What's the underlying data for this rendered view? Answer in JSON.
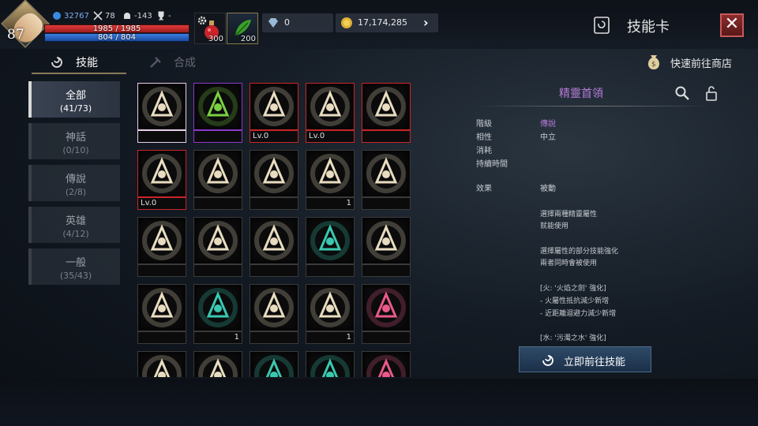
{
  "player": {
    "level": "87",
    "power": "32767",
    "stat_a": "78",
    "stat_b": "-143",
    "stat_c": "-",
    "hp": "1985 / 1985",
    "mp": "804 / 804"
  },
  "consumables": [
    {
      "name": "potion-icon",
      "qty": "300"
    },
    {
      "name": "herb-icon",
      "qty": "200"
    }
  ],
  "currencies": [
    {
      "icon": "diamond-icon",
      "value": "0"
    },
    {
      "icon": "gold-coin-icon",
      "value": "17,174,285"
    }
  ],
  "window": {
    "title": "技能卡",
    "close": "✕"
  },
  "tabs": [
    {
      "label": "技能",
      "active": true
    },
    {
      "label": "合成",
      "active": false
    }
  ],
  "shop_link": "快速前往商店",
  "categories": [
    {
      "name": "全部",
      "count": "(41/73)",
      "active": true
    },
    {
      "name": "神話",
      "count": "(0/10)"
    },
    {
      "name": "傳說",
      "count": "(2/8)"
    },
    {
      "name": "英雄",
      "count": "(4/12)"
    },
    {
      "name": "一般",
      "count": "(35/43)"
    }
  ],
  "cards": [
    {
      "icon": "elemental-shield-icon",
      "rarity": "god",
      "left": "",
      "right": ""
    },
    {
      "icon": "thorn-beast-icon",
      "rarity": "myth",
      "left": "",
      "right": ""
    },
    {
      "icon": "bow-shield-icon",
      "rarity": "leg",
      "left": "Lv.0",
      "right": ""
    },
    {
      "icon": "crossed-blades-icon",
      "rarity": "leg",
      "left": "Lv.0",
      "right": ""
    },
    {
      "icon": "skull-target-icon",
      "rarity": "leg",
      "left": "",
      "right": ""
    },
    {
      "icon": "dragon-wing-icon",
      "rarity": "leg",
      "left": "Lv.0",
      "right": ""
    },
    {
      "icon": "shield-sword-icon",
      "rarity": "none",
      "left": "",
      "right": ""
    },
    {
      "icon": "lightning-sword-icon",
      "rarity": "none",
      "left": "",
      "right": ""
    },
    {
      "icon": "curved-arrow-icon",
      "rarity": "none",
      "left": "",
      "right": "1"
    },
    {
      "icon": "starburst-icon",
      "rarity": "none",
      "left": "",
      "right": ""
    },
    {
      "icon": "anvil-hand-icon",
      "rarity": "none",
      "left": "",
      "right": ""
    },
    {
      "icon": "slash-eye-icon",
      "rarity": "none",
      "left": "",
      "right": ""
    },
    {
      "icon": "spiked-circle-icon",
      "rarity": "none",
      "left": "",
      "right": ""
    },
    {
      "icon": "teal-sword-burst-icon",
      "rarity": "none",
      "left": "",
      "right": ""
    },
    {
      "icon": "orb-spring-icon",
      "rarity": "none",
      "left": "",
      "right": ""
    },
    {
      "icon": "crosshair-person-icon",
      "rarity": "none",
      "left": "",
      "right": ""
    },
    {
      "icon": "cycle-arrows-icon",
      "rarity": "none",
      "left": "",
      "right": "1"
    },
    {
      "icon": "sparkle-burst-icon",
      "rarity": "none",
      "left": "",
      "right": ""
    },
    {
      "icon": "shatter-icon",
      "rarity": "none",
      "left": "",
      "right": "1"
    },
    {
      "icon": "pink-wing-icon",
      "rarity": "none",
      "left": "",
      "right": ""
    },
    {
      "icon": "moon-orb-icon",
      "rarity": "none",
      "left": "",
      "right": ""
    },
    {
      "icon": "flame-claw-icon",
      "rarity": "none",
      "left": "",
      "right": ""
    },
    {
      "icon": "teal-spike-icon",
      "rarity": "none",
      "left": "",
      "right": ""
    },
    {
      "icon": "teal-sparkle-icon",
      "rarity": "none",
      "left": "",
      "right": ""
    },
    {
      "icon": "pink-paws-icon",
      "rarity": "none",
      "left": "",
      "right": ""
    }
  ],
  "detail": {
    "name": "精靈首領",
    "props": [
      {
        "label": "階級",
        "value": "傳說",
        "color": "#b57bd8"
      },
      {
        "label": "相性",
        "value": "中立"
      },
      {
        "label": "消耗",
        "value": ""
      },
      {
        "label": "持續時間",
        "value": ""
      },
      {
        "label": "效果",
        "value": "被動"
      }
    ],
    "desc": [
      "選擇兩種精靈屬性",
      "就能使用",
      "選擇屬性的部分技能強化",
      "兩者同時會被使用",
      "[火: '火焰之劍' 強化]",
      "- 火屬性抵抗減少新增",
      "- 近距離迴避力減少新增",
      "[水: '污濁之水' 強化]"
    ],
    "goto_label": "立即前往技能"
  }
}
